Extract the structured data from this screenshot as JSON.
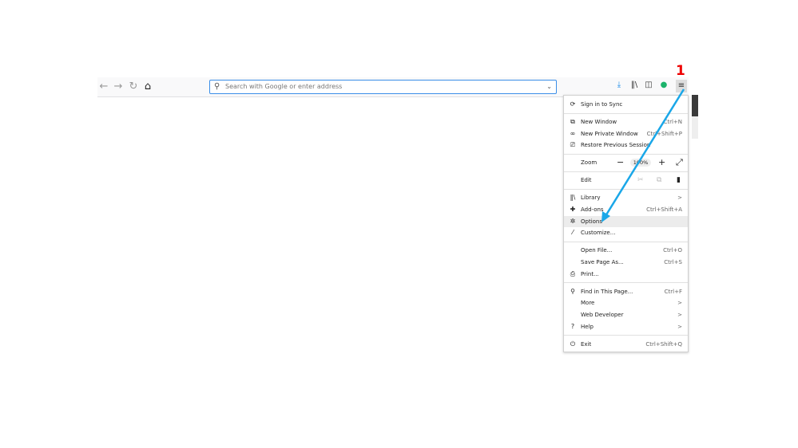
{
  "toolbar": {
    "back_icon": "←",
    "forward_icon": "→",
    "reload_icon": "↻",
    "home_icon": "⌂",
    "search_placeholder": "Search with Google or enter address"
  },
  "annotation": {
    "step": "1",
    "arrow_color": "#1aa7e8"
  },
  "menu": {
    "sync": "Sign in to Sync",
    "new_window": {
      "label": "New Window",
      "shortcut": "Ctrl+N"
    },
    "private_window": {
      "label": "New Private Window",
      "shortcut": "Ctrl+Shift+P"
    },
    "restore": "Restore Previous Session",
    "zoom": {
      "label": "Zoom",
      "value": "100%"
    },
    "edit": "Edit",
    "library": "Library",
    "addons": {
      "label": "Add-ons",
      "shortcut": "Ctrl+Shift+A"
    },
    "options": "Options",
    "customize": "Customize...",
    "open_file": {
      "label": "Open File...",
      "shortcut": "Ctrl+O"
    },
    "save_page": {
      "label": "Save Page As...",
      "shortcut": "Ctrl+S"
    },
    "print": "Print...",
    "find": {
      "label": "Find in This Page...",
      "shortcut": "Ctrl+F"
    },
    "more": "More",
    "web_dev": "Web Developer",
    "help": "Help",
    "exit": {
      "label": "Exit",
      "shortcut": "Ctrl+Shift+Q"
    },
    "chevron": ">"
  }
}
